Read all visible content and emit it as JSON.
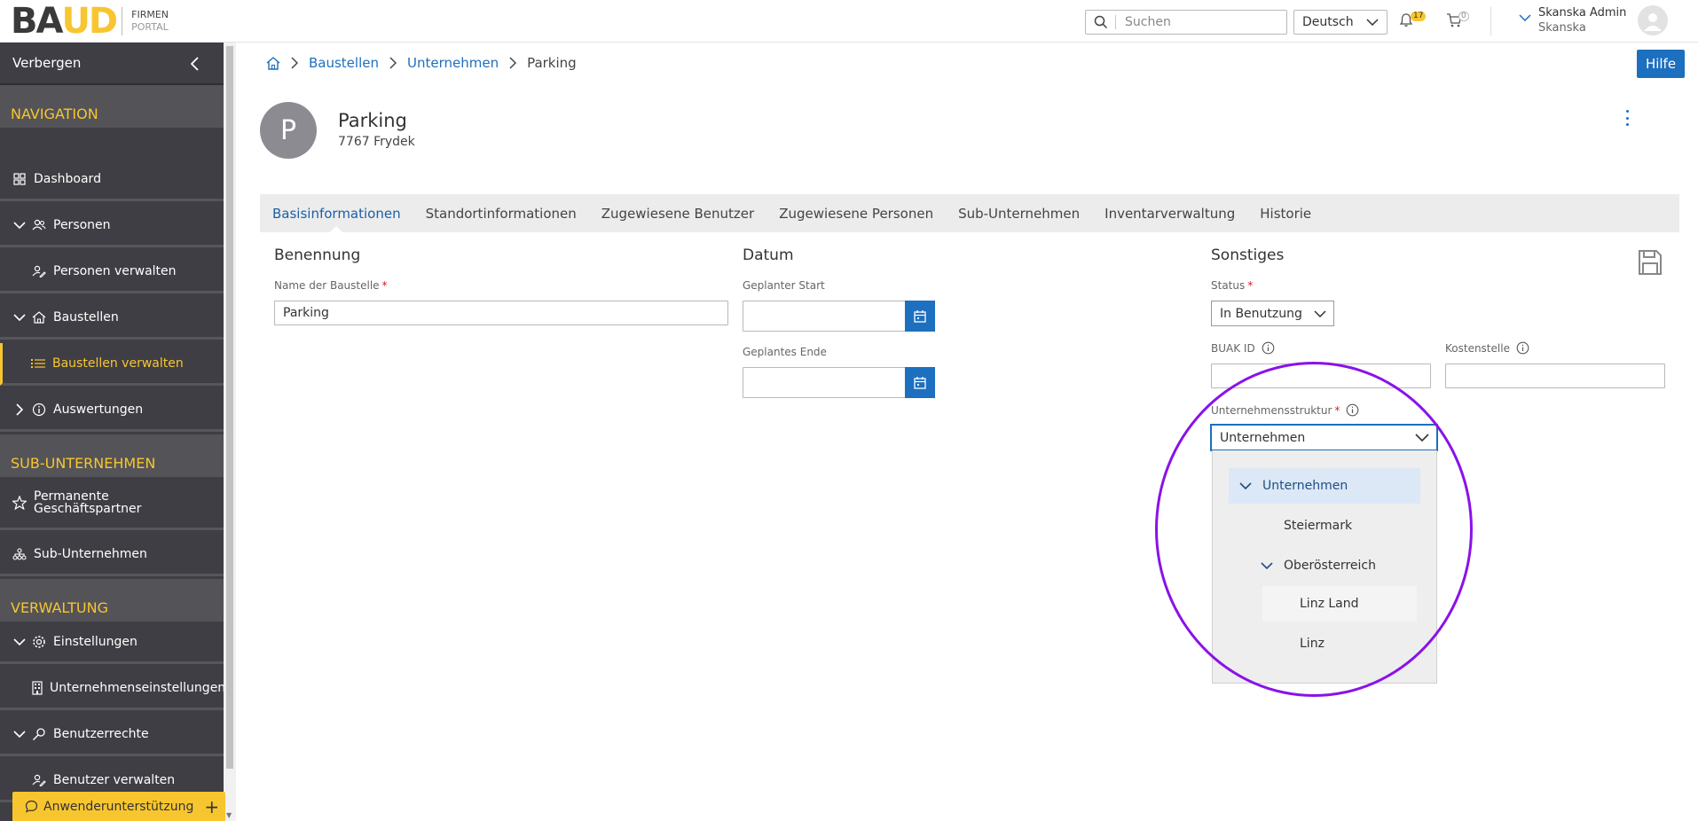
{
  "header": {
    "logo": {
      "brand_part1": "BA",
      "brand_part2": "UD",
      "line1": "FIRMEN",
      "line2": "PORTAL"
    },
    "search": {
      "placeholder": "Suchen"
    },
    "language": "Deutsch",
    "notifications_count": "17",
    "cart_count": "0",
    "user": {
      "name": "Skanska Admin",
      "company": "Skanska"
    }
  },
  "sidebar": {
    "hide_label": "Verbergen",
    "sections": {
      "navigation": "NAVIGATION",
      "sub_unternehmen": "SUB-UNTERNEHMEN",
      "verwaltung": "VERWALTUNG"
    },
    "items": {
      "dashboard": "Dashboard",
      "personen": "Personen",
      "personen_verwalten": "Personen verwalten",
      "baustellen": "Baustellen",
      "baustellen_verwalten": "Baustellen verwalten",
      "auswertungen": "Auswertungen",
      "permanente_line1": "Permanente",
      "permanente_line2": "Geschäftspartner",
      "sub_unternehmen": "Sub-Unternehmen",
      "einstellungen": "Einstellungen",
      "unternehmenseinstellungen": "Unternehmenseinstellungen",
      "benutzerrechte": "Benutzerrechte",
      "benutzer_verwalten": "Benutzer verwalten"
    },
    "support_label": "Anwenderunterstützung"
  },
  "breadcrumb": {
    "item1": "Baustellen",
    "item2": "Unternehmen",
    "current": "Parking"
  },
  "help_label": "Hilfe",
  "page": {
    "avatar_letter": "P",
    "title": "Parking",
    "subtitle": "7767 Frydek"
  },
  "tabs": [
    "Basisinformationen",
    "Standortinformationen",
    "Zugewiesene Benutzer",
    "Zugewiesene Personen",
    "Sub-Unternehmen",
    "Inventarverwaltung",
    "Historie"
  ],
  "form": {
    "benennung": {
      "title": "Benennung",
      "name_label": "Name der Baustelle",
      "name_value": "Parking"
    },
    "datum": {
      "title": "Datum",
      "start_label": "Geplanter Start",
      "start_value": "",
      "end_label": "Geplantes Ende",
      "end_value": ""
    },
    "sonstiges": {
      "title": "Sonstiges",
      "status_label": "Status",
      "status_value": "In Benutzung",
      "buak_label": "BUAK ID",
      "buak_value": "",
      "kosten_label": "Kostenstelle",
      "kosten_value": "",
      "struktur_label": "Unternehmensstruktur",
      "struktur_value": "Unternehmen",
      "required_marker": "*"
    }
  },
  "dropdown": {
    "items": [
      "Unternehmen",
      "Steiermark",
      "Oberösterreich",
      "Linz Land",
      "Linz"
    ]
  },
  "colors": {
    "accent_blue": "#1d6fbf",
    "brand_yellow": "#f7c62f",
    "sidebar_bg": "#3f3e44",
    "highlight_ring": "#8a12ea"
  }
}
